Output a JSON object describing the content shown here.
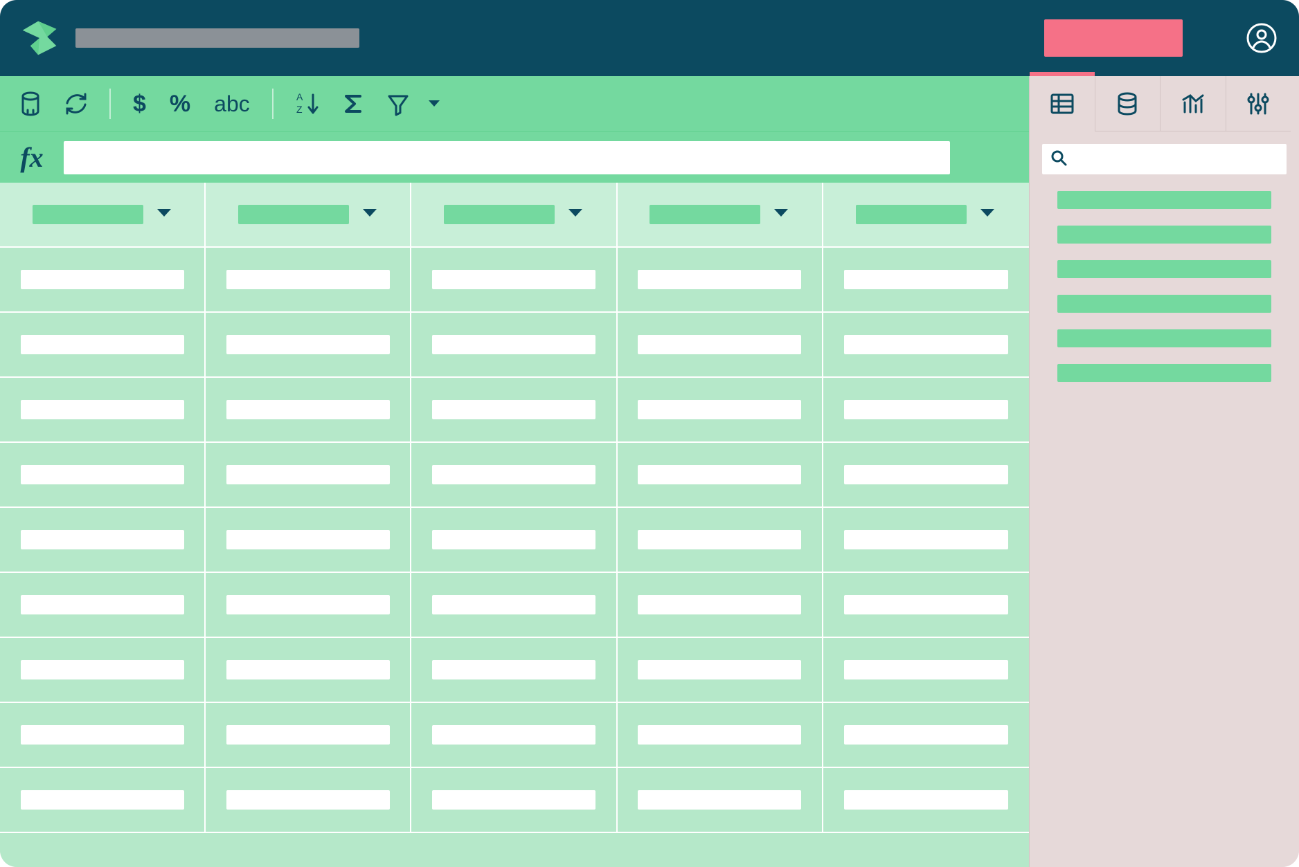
{
  "header": {
    "title_placeholder": "",
    "accent_label": ""
  },
  "toolbar": {
    "database_tooltip": "Database",
    "refresh_tooltip": "Refresh",
    "currency_label": "$",
    "percent_label": "%",
    "text_label": "abc",
    "sort_tooltip": "Sort A→Z",
    "aggregate_tooltip": "Aggregate",
    "filter_tooltip": "Filter"
  },
  "formula": {
    "fx_label": "fx",
    "value": ""
  },
  "grid": {
    "columns": [
      {
        "label": ""
      },
      {
        "label": ""
      },
      {
        "label": ""
      },
      {
        "label": ""
      },
      {
        "label": ""
      }
    ],
    "rows": [
      [
        "",
        "",
        "",
        "",
        ""
      ],
      [
        "",
        "",
        "",
        "",
        ""
      ],
      [
        "",
        "",
        "",
        "",
        ""
      ],
      [
        "",
        "",
        "",
        "",
        ""
      ],
      [
        "",
        "",
        "",
        "",
        ""
      ],
      [
        "",
        "",
        "",
        "",
        ""
      ],
      [
        "",
        "",
        "",
        "",
        ""
      ],
      [
        "",
        "",
        "",
        "",
        ""
      ],
      [
        "",
        "",
        "",
        "",
        ""
      ]
    ]
  },
  "sidebar": {
    "tabs": [
      {
        "name": "table",
        "active": true
      },
      {
        "name": "database",
        "active": false
      },
      {
        "name": "chart",
        "active": false
      },
      {
        "name": "settings",
        "active": false
      }
    ],
    "search_placeholder": "",
    "items": [
      "",
      "",
      "",
      "",
      "",
      ""
    ]
  }
}
